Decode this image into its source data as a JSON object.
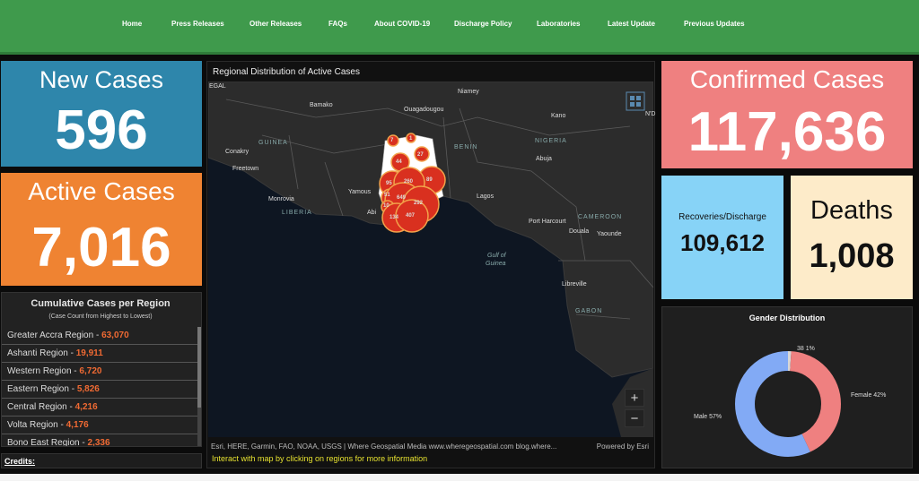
{
  "nav": [
    "Home",
    "Press Releases",
    "Other Releases",
    "FAQs",
    "About COVID-19",
    "Discharge Policy",
    "Laboratories",
    "Latest Update",
    "Previous Updates"
  ],
  "tiles": {
    "new_cases": {
      "label": "New Cases",
      "value": "596",
      "color": "#2e86ab"
    },
    "active_cases": {
      "label": "Active Cases",
      "value": "7,016",
      "color": "#ef8332"
    },
    "confirmed": {
      "label": "Confirmed Cases",
      "value": "117,636",
      "color": "#ef8080"
    },
    "recoveries": {
      "label": "Recoveries/Discharge",
      "value": "109,612",
      "color": "#87d3f7"
    },
    "deaths": {
      "label": "Deaths",
      "value": "1,008",
      "color": "#fdebc9"
    }
  },
  "regions": {
    "title": "Cumulative Cases per Region",
    "subtitle": "(Case Count from Highest to Lowest)",
    "items": [
      {
        "name": "Greater Accra Region",
        "count": "63,070"
      },
      {
        "name": "Ashanti Region",
        "count": "19,911"
      },
      {
        "name": "Western Region",
        "count": "6,720"
      },
      {
        "name": "Eastern Region",
        "count": "5,826"
      },
      {
        "name": "Central Region",
        "count": "4,216"
      },
      {
        "name": "Volta Region",
        "count": "4,176"
      },
      {
        "name": "Bono East Region",
        "count": "2,336"
      }
    ]
  },
  "credits": "Credits:",
  "map": {
    "title": "Regional Distribution of Active Cases",
    "attribution": "Esri, HERE, Garmin, FAO, NOAA, USGS | Where Geospatial Media www.wheregeospatial.com blog.where...",
    "powered": "Powered by Esri",
    "interact": "Interact with map by clicking on regions for more information",
    "zoom_in": "+",
    "zoom_out": "−",
    "places": [
      "EGAL",
      "Niamey",
      "Bamako",
      "Ouagadougou",
      "Kano",
      "N'D",
      "Conakry",
      "GUINEA",
      "BENIN",
      "NIGERIA",
      "Freetown",
      "Abuja",
      "Monrovia",
      "Yamous",
      "LIBERIA",
      "Lagos",
      "Abi",
      "Port Harcourt",
      "CAMEROON",
      "Douala",
      "Yaounde",
      "Gulf of",
      "Guinea",
      "Libreville",
      "GABON"
    ],
    "clusters": [
      "7",
      "1",
      "27",
      "44",
      "95",
      "260",
      "89",
      "51",
      "649",
      "10",
      "292",
      "134",
      "407"
    ]
  },
  "gender": {
    "title": "Gender Distribution",
    "slices": [
      {
        "label": "Female 42%",
        "value": 42,
        "color": "#ef8080"
      },
      {
        "label": "Male 57%",
        "value": 57,
        "color": "#82aaf5"
      },
      {
        "label": "38 1%",
        "value": 1,
        "color": "#d7d7d7"
      }
    ]
  }
}
